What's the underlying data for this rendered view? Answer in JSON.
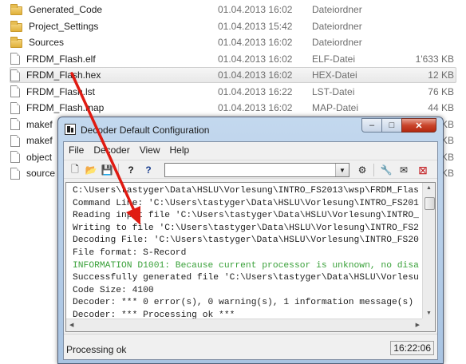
{
  "files": [
    {
      "name": "Generated_Code",
      "date": "01.04.2013 16:02",
      "type": "Dateiordner",
      "size": "",
      "kind": "folder"
    },
    {
      "name": "Project_Settings",
      "date": "01.04.2013 15:42",
      "type": "Dateiordner",
      "size": "",
      "kind": "folder"
    },
    {
      "name": "Sources",
      "date": "01.04.2013 16:02",
      "type": "Dateiordner",
      "size": "",
      "kind": "folder"
    },
    {
      "name": "FRDM_Flash.elf",
      "date": "01.04.2013 16:02",
      "type": "ELF-Datei",
      "size": "1'633 KB",
      "kind": "file"
    },
    {
      "name": "FRDM_Flash.hex",
      "date": "01.04.2013 16:02",
      "type": "HEX-Datei",
      "size": "12 KB",
      "kind": "file",
      "selected": true
    },
    {
      "name": "FRDM_Flash.lst",
      "date": "01.04.2013 16:22",
      "type": "LST-Datei",
      "size": "76 KB",
      "kind": "file"
    },
    {
      "name": "FRDM_Flash.map",
      "date": "01.04.2013 16:02",
      "type": "MAP-Datei",
      "size": "44 KB",
      "kind": "file"
    },
    {
      "name": "makef",
      "date": "",
      "type": "",
      "size": "KB",
      "kind": "file"
    },
    {
      "name": "makef",
      "date": "",
      "type": "",
      "size": "KB",
      "kind": "file"
    },
    {
      "name": "object",
      "date": "",
      "type": "",
      "size": "KB",
      "kind": "file"
    },
    {
      "name": "source",
      "date": "",
      "type": "",
      "size": "KB",
      "kind": "file"
    }
  ],
  "window": {
    "title": "Decoder  Default Configuration",
    "minimize": "‒",
    "maximize": "□",
    "close": "✕"
  },
  "menu": [
    "File",
    "Decoder",
    "View",
    "Help"
  ],
  "toolbar": {
    "icons": [
      "new-file-icon",
      "open-folder-icon",
      "save-icon",
      "help-icon",
      "context-help-icon",
      "dropdown-arrow-icon",
      "decode-icon",
      "options-wrench-icon",
      "mail-icon",
      "stop-icon"
    ],
    "glyphs": {
      "new": "🗋",
      "open": "📂",
      "save": "💾",
      "help": "?",
      "context_help": "?",
      "arrow": "▼",
      "decode": "⚙",
      "wrench": "🔧",
      "mail": "✉",
      "stop": "⊠"
    },
    "combo_value": ""
  },
  "output_lines": [
    {
      "text": "C:\\Users\\tastyger\\Data\\HSLU\\Vorlesung\\INTRO_FS2013\\wsp\\FRDM_Flas",
      "kind": "normal"
    },
    {
      "text": "Command Line: 'C:\\Users\\tastyger\\Data\\HSLU\\Vorlesung\\INTRO_FS201",
      "kind": "normal"
    },
    {
      "text": "Reading input file 'C:\\Users\\tastyger\\Data\\HSLU\\Vorlesung\\INTRO_",
      "kind": "normal"
    },
    {
      "text": "Writing to file 'C:\\Users\\tastyger\\Data\\HSLU\\Vorlesung\\INTRO_FS2",
      "kind": "normal"
    },
    {
      "text": "Decoding File: 'C:\\Users\\tastyger\\Data\\HSLU\\Vorlesung\\INTRO_FS20",
      "kind": "normal"
    },
    {
      "text": "File format: S-Record",
      "kind": "normal"
    },
    {
      "text": "INFORMATION D1001: Because current processor is unknown, no disa",
      "kind": "info"
    },
    {
      "text": "Successfully generated file 'C:\\Users\\tastyger\\Data\\HSLU\\Vorlesu",
      "kind": "normal"
    },
    {
      "text": "Code Size: 4100",
      "kind": "normal"
    },
    {
      "text": "Decoder: *** 0 error(s), 0 warning(s), 1 information message(s)",
      "kind": "normal"
    },
    {
      "text": "Decoder: *** Processing ok ***",
      "kind": "normal"
    }
  ],
  "status": {
    "text": "Processing ok",
    "time": "16:22:06"
  },
  "colors": {
    "info_text": "#3aa13a",
    "annotation_arrow": "#e01b12",
    "selection": "#e8e8e8"
  }
}
